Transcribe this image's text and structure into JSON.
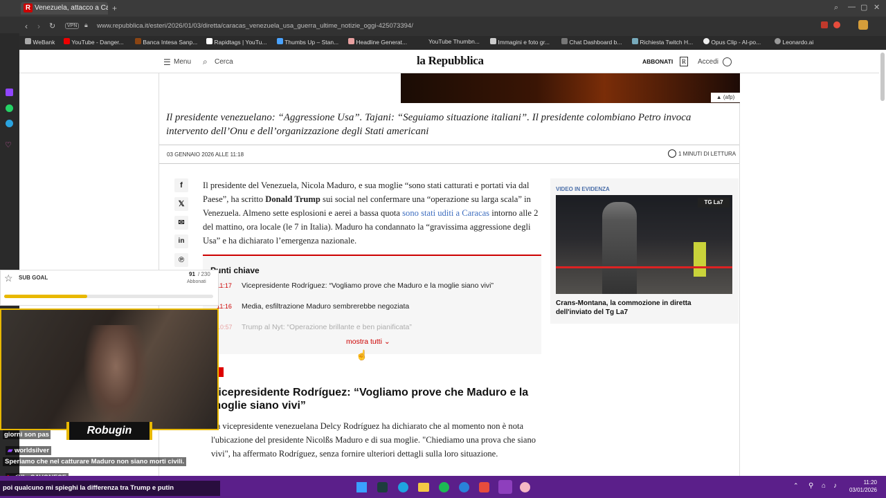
{
  "browser": {
    "tab_title": "Venezuela, attacco a Carac",
    "tab_icon_letter": "R",
    "new_tab": "+",
    "vpn": "VPN",
    "url": "www.repubblica.it/esteri/2026/01/03/diretta/caracas_venezuela_usa_guerra_ultime_notizie_oggi-425073394/",
    "bookmarks": [
      "WeBank",
      "YouTube - Danger...",
      "Banca Intesa Sanp...",
      "Rapidtags | YouTu...",
      "Thumbs Up – Stan...",
      "Headline Generat...",
      "YouTube Thumbn...",
      "Immagini e foto gr...",
      "Chat Dashboard b...",
      "Richiesta Twitch H...",
      "Opus Clip - AI-po...",
      "Leonardo.ai"
    ]
  },
  "site": {
    "menu": "Menu",
    "search": "Cerca",
    "logo": "la Repubblica",
    "subscribe": "ABBONATI",
    "subscribe_badge": "R",
    "login": "Accedi"
  },
  "article": {
    "photo_credit": "▲ (afp)",
    "summary": "Il presidente venezuelano: “Aggressione Usa”. Tajani: “Seguiamo situazione italiani”. Il presidente colombiano Petro invoca intervento dell’Onu e dell’organizzazione degli Stati americani",
    "date": "03 GENNAIO 2026 ALLE 11:18",
    "read_time": "1 MINUTI DI LETTURA",
    "body_a": "Il presidente del Venezuela, Nicola Maduro, e sua moglie “sono stati catturati e portati via dal Paese”, ha scritto ",
    "body_bold": "Donald Trump",
    "body_b": " sui social nel confermare una “operazione su larga scala” in Venezuela. Almeno sette esplosioni e aerei a bassa quota ",
    "body_link": "sono stati uditi a Caracas",
    "body_c": " intorno alle 2 del mattino, ora locale (le 7 in Italia). Maduro ha condannato la “gravissima aggressione degli Usa” e ha dichiarato l’emergenza nazionale.",
    "key_points_title": "Punti chiave",
    "key_points": [
      {
        "time": "11:17",
        "text": "Vicepresidente Rodríguez: “Vogliamo prove che Maduro e la moglie siano vivi”"
      },
      {
        "time": "11:16",
        "text": "Media, esfiltrazione Maduro sembrerebbe negoziata"
      },
      {
        "time": "10:57",
        "text": "Trump al Nyt: “Operazione brillante e ben pianificata”"
      }
    ],
    "show_all": "mostra tutti ⌄",
    "section_heading": "Vicepresidente Rodríguez: “Vogliamo prove che Maduro e la moglie siano vivi”",
    "section_body": "La vicepresidente venezuelana Delcy Rodríguez ha dichiarato che al momento non è nota l'ubicazione del presidente Nicolßs Maduro e di sua moglie. \"Chiediamo una prova che siano vivi\", ha affermato Rodríguez, senza fornire ulteriori dettagli sulla loro situazione."
  },
  "video": {
    "label": "VIDEO IN EVIDENZA",
    "badge": "TG La7",
    "title": "Crans-Montana, la commozione in diretta dell'inviato del Tg La7"
  },
  "stream_overlay": {
    "sub_goal_label": "SUB GOAL",
    "sub_goal_current": "91",
    "sub_goal_total": "/ 230",
    "sub_goal_unit": "Abbonati",
    "sub_goal_progress": 0.396,
    "streamer_name": "Robugin",
    "chat": [
      {
        "user": "",
        "text": "giorni son pas"
      },
      {
        "user": "worldsilver",
        "text": "Speriamo che nel catturare Maduro non siano morti civili."
      },
      {
        "user": "@IL_SAVONESE",
        "text": "poi qualcuno mi spieghi la differenza tra Trump e putin"
      }
    ]
  },
  "taskbar": {
    "time": "11:20",
    "date": "03/01/2026"
  },
  "colors": {
    "accent_red": "#cc0000",
    "link_blue": "#3d6dbf",
    "taskbar_purple": "#5b1f8a",
    "goal_yellow": "#e8b800"
  }
}
